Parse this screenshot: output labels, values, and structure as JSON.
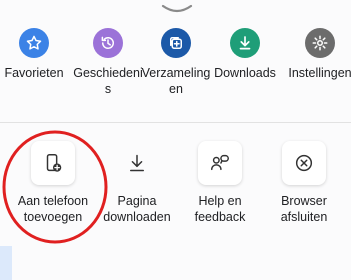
{
  "top_actions": [
    {
      "id": "favorieten",
      "label": "Favorieten",
      "icon": "star-icon",
      "color": "#3b82e6"
    },
    {
      "id": "geschiedenis",
      "label": "Geschiedeni\ns",
      "icon": "history-icon",
      "color": "#9b72d8"
    },
    {
      "id": "verzamelingen",
      "label": "Verzameling\nen",
      "icon": "collections-icon",
      "color": "#1c59a8"
    },
    {
      "id": "downloads",
      "label": "Downloads",
      "icon": "download-icon",
      "color": "#1f9e78"
    },
    {
      "id": "instellingen",
      "label": "Instellingen",
      "icon": "gear-icon",
      "color": "#6c6c6c"
    }
  ],
  "bottom_actions": [
    {
      "id": "add-to-phone",
      "label": "Aan telefoon\ntoevoegen",
      "icon": "add-to-phone-icon"
    },
    {
      "id": "download-page",
      "label": "Pagina\ndownloaden",
      "icon": "download-icon"
    },
    {
      "id": "help-feedback",
      "label": "Help en\nfeedback",
      "icon": "feedback-icon"
    },
    {
      "id": "close-browser",
      "label": "Browser\nafsluiten",
      "icon": "close-circle-icon"
    }
  ],
  "annotation_color": "#e02020"
}
